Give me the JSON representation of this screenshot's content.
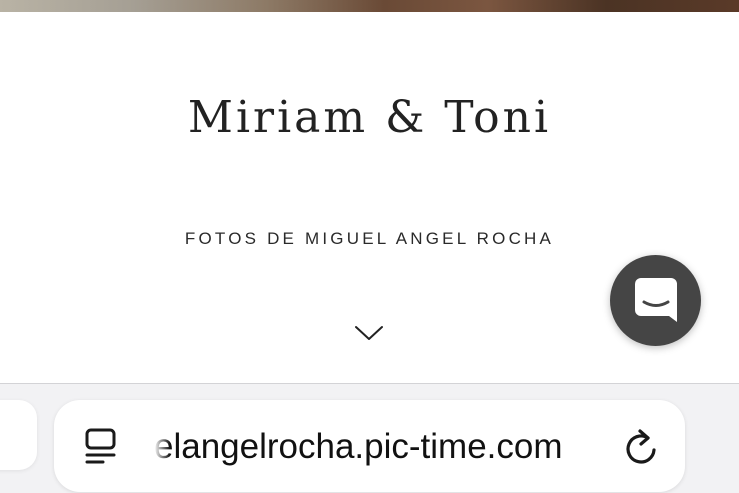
{
  "page": {
    "title": "Miriam & Toni",
    "subtitle": "FOTOS DE MIGUEL ANGEL ROCHA",
    "scroll_icon": "chevron-down-icon"
  },
  "chat_widget": {
    "icon": "chat-bubble-icon",
    "background_color": "#454545"
  },
  "browser_toolbar": {
    "url": "elangelrocha.pic-time.com",
    "left_icon": "tab-overview-icon",
    "right_icon": "reload-icon"
  }
}
